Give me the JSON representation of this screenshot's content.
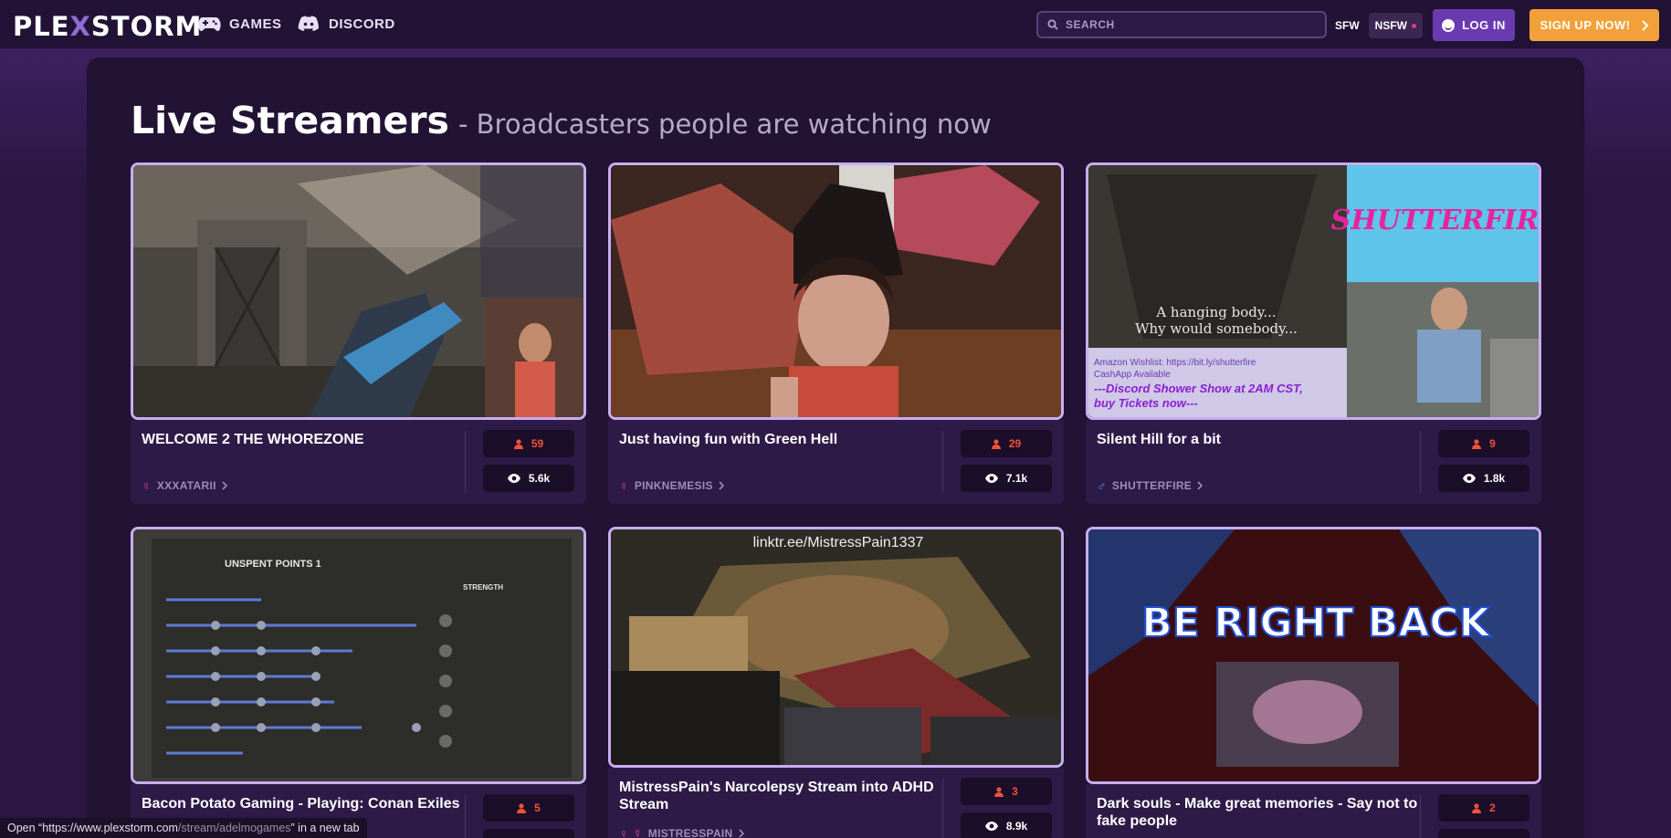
{
  "nav": {
    "logo_left": "PLE",
    "logo_x": "X",
    "logo_right": "STORM",
    "games": "GAMES",
    "discord": "DISCORD",
    "search_placeholder": "SEARCH",
    "sfw": "SFW",
    "nsfw": "NSFW",
    "login": "LOG IN",
    "signup": "SIGN UP NOW!"
  },
  "page": {
    "title": "Live Streamers",
    "subtitle": "- Broadcasters people are watching now"
  },
  "cards": [
    {
      "title": "WELCOME 2 THE WHOREZONE",
      "user": "XXXATARII",
      "gender": "♀",
      "viewers": "59",
      "views": "5.6k",
      "thumb_text": ""
    },
    {
      "title": "Just having fun with Green Hell",
      "user": "PINKNEMESIS",
      "gender": "♀",
      "viewers": "29",
      "views": "7.1k",
      "thumb_text": ""
    },
    {
      "title": "Silent Hill for a bit",
      "user": "SHUTTERFIRE",
      "gender": "♂",
      "viewers": "9",
      "views": "1.8k",
      "thumb_text": "SHUTTERFIRE",
      "caption1": "A hanging body...",
      "caption2": "Why would somebody...",
      "wish1": "Amazon Wishlist: https://bit.ly/shutterfire",
      "wish2": "CashApp Available",
      "wish3": "---Discord Shower Show at 2AM CST,",
      "wish4": "buy Tickets now---"
    },
    {
      "title": "Bacon Potato Gaming - Playing: Conan Exiles",
      "user": "",
      "gender": "",
      "viewers": "5",
      "views": "",
      "thumb_text": "UNSPENT POINTS  1",
      "label_strength": "STRENGTH"
    },
    {
      "title": "MistressPain's Narcolepsy Stream into ADHD Stream",
      "user": "MISTRESSPAIN",
      "gender": "♀ ☿",
      "viewers": "3",
      "views": "8.9k",
      "thumb_text": "linktr.ee/MistressPain1337"
    },
    {
      "title": "Dark souls - Make great memories - Say not to fake people",
      "user": "",
      "gender": "",
      "viewers": "2",
      "views": "",
      "thumb_text": "BE RIGHT BACK"
    }
  ],
  "status_bar": {
    "prefix": "Open “https://www.plexstorm.com",
    "path": "/stream/adelmogames",
    "suffix": "” in a new tab"
  }
}
